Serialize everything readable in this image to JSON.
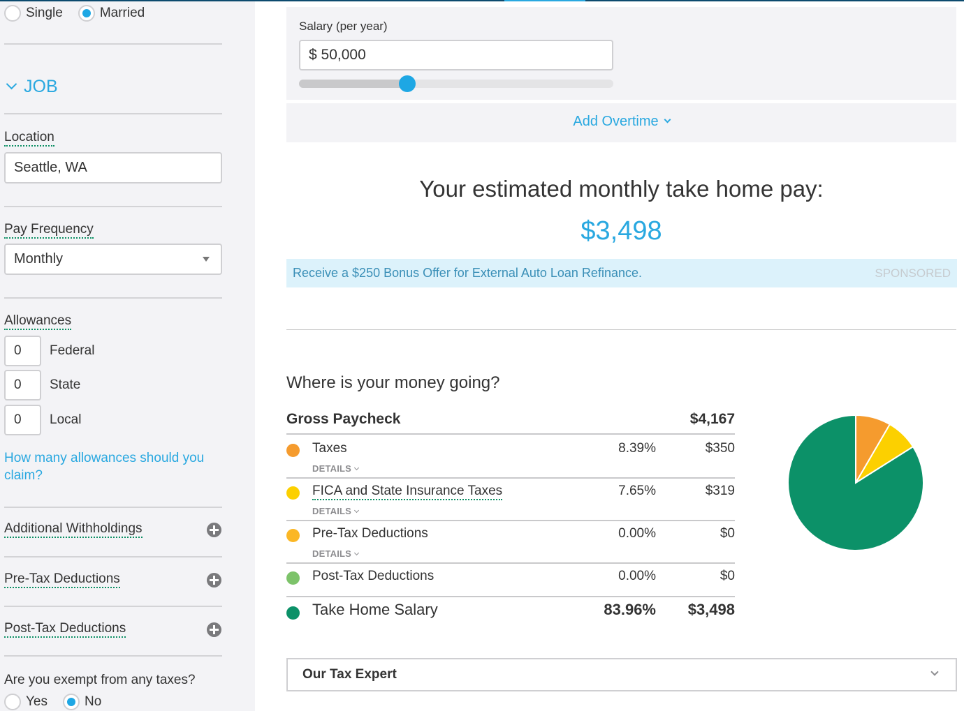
{
  "filing_status": {
    "options": [
      {
        "label": "Single",
        "checked": false
      },
      {
        "label": "Married",
        "checked": true
      }
    ]
  },
  "job_section": {
    "title": "JOB",
    "expanded": true
  },
  "location": {
    "label": "Location",
    "value": "Seattle, WA"
  },
  "pay_frequency": {
    "label": "Pay Frequency",
    "value": "Monthly"
  },
  "allowances": {
    "label": "Allowances",
    "items": [
      {
        "value": "0",
        "label": "Federal"
      },
      {
        "value": "0",
        "label": "State"
      },
      {
        "value": "0",
        "label": "Local"
      }
    ],
    "help_link": "How many allowances should you claim?"
  },
  "expanders": [
    {
      "label": "Additional Withholdings"
    },
    {
      "label": "Pre-Tax Deductions"
    },
    {
      "label": "Post-Tax Deductions"
    }
  ],
  "exempt": {
    "question": "Are you exempt from any taxes?",
    "options": [
      {
        "label": "Yes",
        "checked": false
      },
      {
        "label": "No",
        "checked": true
      }
    ]
  },
  "salary": {
    "label": "Salary (per year)",
    "value": "$ 50,000",
    "slider_fraction": 0.344
  },
  "overtime": {
    "label": "Add Overtime"
  },
  "estimate": {
    "title": "Your estimated monthly take home pay:",
    "value": "$3,498"
  },
  "promo": {
    "text": "Receive a $250 Bonus Offer for External Auto Loan Refinance.",
    "badge": "SPONSORED"
  },
  "breakdown": {
    "title": "Where is your money going?",
    "gross_label": "Gross Paycheck",
    "gross_value": "$4,167",
    "details_label": "DETAILS",
    "rows": [
      {
        "label": "Taxes",
        "percent": "8.39%",
        "amount": "$350",
        "color": "#f59b2e",
        "details": true
      },
      {
        "label": "FICA and State Insurance Taxes",
        "percent": "7.65%",
        "amount": "$319",
        "color": "#fcd000",
        "details": true
      },
      {
        "label": "Pre-Tax Deductions",
        "percent": "0.00%",
        "amount": "$0",
        "color": "#fbb725",
        "details": true
      },
      {
        "label": "Post-Tax Deductions",
        "percent": "0.00%",
        "amount": "$0",
        "color": "#7dc36a",
        "details": false
      },
      {
        "label": "Take Home Salary",
        "percent": "83.96%",
        "amount": "$3,498",
        "color": "#0c9168",
        "details": false
      }
    ]
  },
  "chart_data": {
    "type": "pie",
    "title": "",
    "labels": [
      "Taxes",
      "FICA and State Insurance Taxes",
      "Pre-Tax Deductions",
      "Post-Tax Deductions",
      "Take Home Salary"
    ],
    "values": [
      8.39,
      7.65,
      0.0,
      0.0,
      83.96
    ],
    "colors": [
      "#f59b2e",
      "#fcd000",
      "#fbb725",
      "#7dc36a",
      "#0c9168"
    ],
    "start": "top",
    "direction": "clockwise"
  },
  "tax_expert": {
    "label": "Our Tax Expert"
  }
}
